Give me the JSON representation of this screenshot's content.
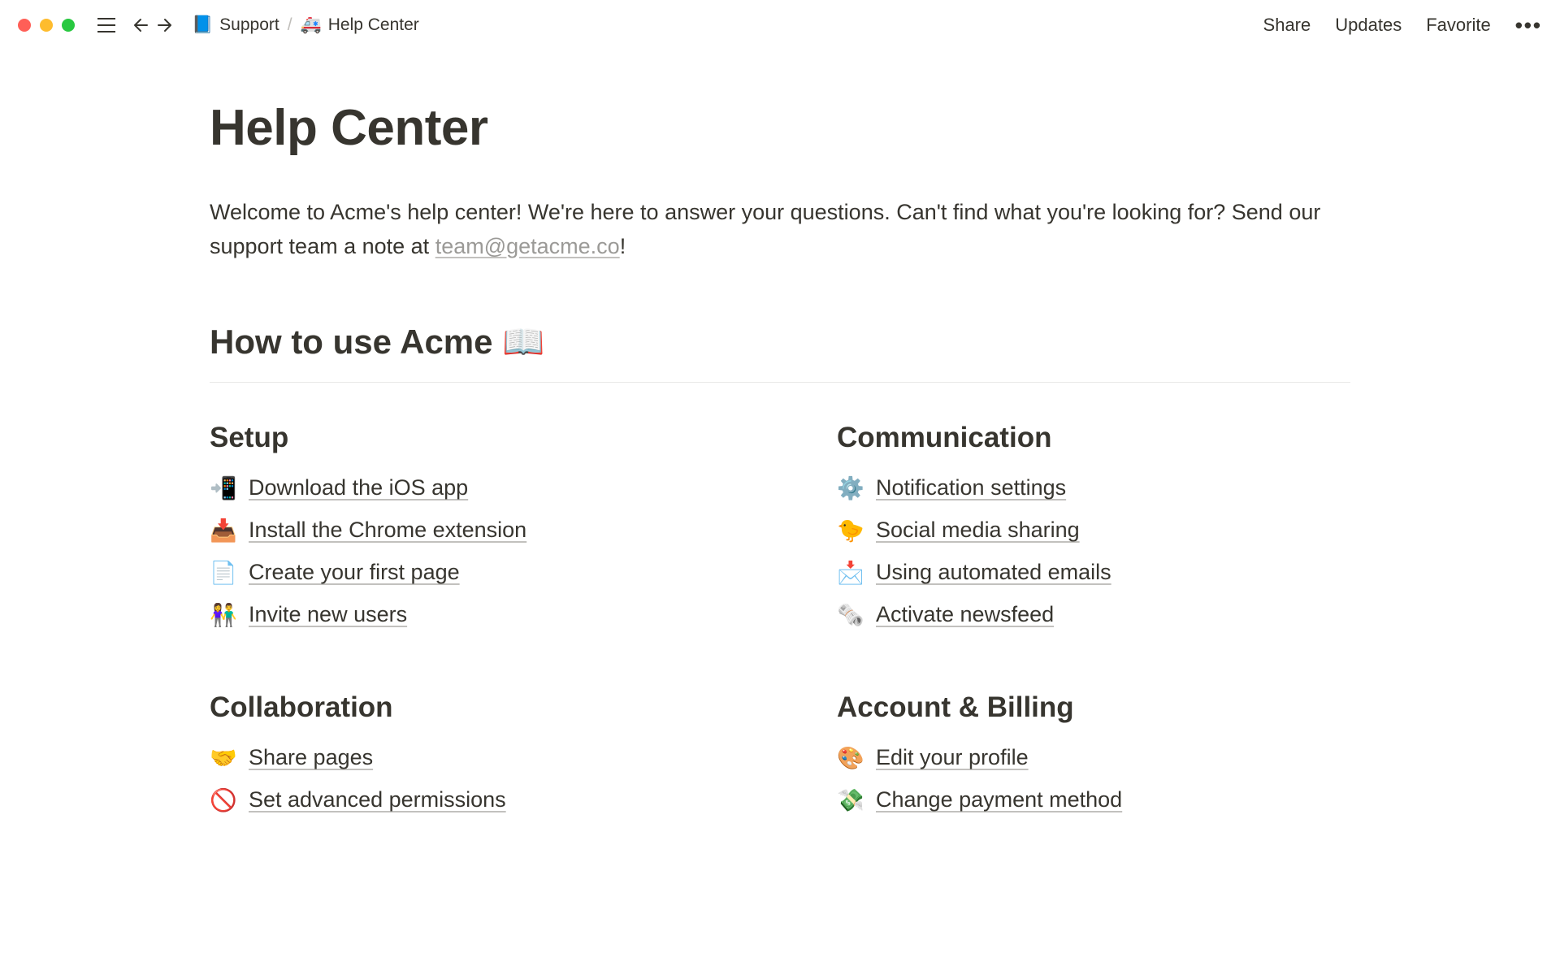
{
  "topbar": {
    "breadcrumb": [
      {
        "icon": "📘",
        "label": "Support"
      },
      {
        "icon": "🚑",
        "label": "Help Center"
      }
    ],
    "breadcrumb_sep": "/",
    "actions": {
      "share": "Share",
      "updates": "Updates",
      "favorite": "Favorite"
    }
  },
  "page": {
    "title": "Help Center",
    "intro_before": "Welcome to Acme's help center! We're here to answer your questions. Can't find what you're looking for? Send our support team a note at ",
    "intro_link": "team@getacme.co",
    "intro_after": "!"
  },
  "guide": {
    "title": "How to use Acme ",
    "emoji": "📖"
  },
  "columns": {
    "setup": {
      "heading": "Setup",
      "items": [
        {
          "icon": "📲",
          "label": "Download the iOS app"
        },
        {
          "icon": "📥",
          "label": "Install the Chrome extension"
        },
        {
          "icon": "📄",
          "label": "Create your first page"
        },
        {
          "icon": "👫",
          "label": "Invite new users"
        }
      ]
    },
    "communication": {
      "heading": "Communication",
      "items": [
        {
          "icon": "⚙️",
          "label": "Notification settings"
        },
        {
          "icon": "🐤",
          "label": "Social media sharing"
        },
        {
          "icon": "📩",
          "label": "Using automated emails"
        },
        {
          "icon": "🗞️",
          "label": "Activate newsfeed"
        }
      ]
    },
    "collaboration": {
      "heading": "Collaboration",
      "items": [
        {
          "icon": "🤝",
          "label": "Share pages"
        },
        {
          "icon": "🚫",
          "label": "Set advanced permissions"
        }
      ]
    },
    "account": {
      "heading": "Account & Billing",
      "items": [
        {
          "icon": "🎨",
          "label": "Edit your profile"
        },
        {
          "icon": "💸",
          "label": "Change payment method"
        }
      ]
    }
  }
}
